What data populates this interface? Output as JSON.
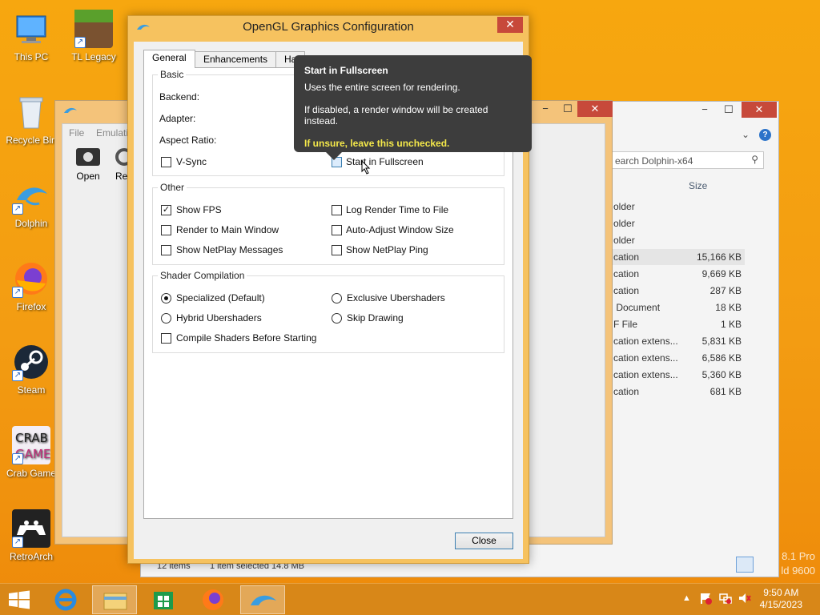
{
  "desktop": {
    "icons": [
      {
        "label": "This PC"
      },
      {
        "label": "TL Legacy"
      },
      {
        "label": "Recycle Bin"
      },
      {
        "label": "Dolphin"
      },
      {
        "label": "Firefox"
      },
      {
        "label": "Steam"
      },
      {
        "label": "Crab Game"
      },
      {
        "label": "RetroArch"
      }
    ],
    "watermark": [
      "8.1 Pro",
      "ld 9600"
    ]
  },
  "dolphin_main": {
    "menu": [
      "File",
      "Emulati"
    ],
    "toolbar": [
      "Open",
      "Re"
    ]
  },
  "explorer": {
    "search_placeholder": "earch Dolphin-x64",
    "size_header": "Size",
    "rows": [
      {
        "type": "older",
        "size": ""
      },
      {
        "type": "older",
        "size": ""
      },
      {
        "type": "older",
        "size": ""
      },
      {
        "type": "cation",
        "size": "15,166 KB"
      },
      {
        "type": "cation",
        "size": "9,669 KB"
      },
      {
        "type": "cation",
        "size": "287 KB"
      },
      {
        "type": " Document",
        "size": "18 KB"
      },
      {
        "type": "F File",
        "size": "1 KB"
      },
      {
        "type": "cation extens...",
        "size": "5,831 KB"
      },
      {
        "type": "cation extens...",
        "size": "6,586 KB"
      },
      {
        "type": "cation extens...",
        "size": "5,360 KB"
      },
      {
        "type": "cation",
        "size": "681 KB"
      }
    ],
    "status": {
      "items": "12 items",
      "selected": "1 item selected  14.8 MB"
    }
  },
  "dialog": {
    "title": "OpenGL Graphics Configuration",
    "tabs": [
      "General",
      "Enhancements",
      "Ha"
    ],
    "basic": {
      "title": "Basic",
      "backend_label": "Backend:",
      "adapter_label": "Adapter:",
      "aspect_label": "Aspect Ratio:",
      "vsync": "V-Sync",
      "fullscreen": "Start in Fullscreen"
    },
    "other": {
      "title": "Other",
      "show_fps": "Show FPS",
      "log_render": "Log Render Time to File",
      "render_main": "Render to Main Window",
      "auto_adjust": "Auto-Adjust Window Size",
      "netplay_msgs": "Show NetPlay Messages",
      "netplay_ping": "Show NetPlay Ping"
    },
    "shader": {
      "title": "Shader Compilation",
      "specialized": "Specialized (Default)",
      "exclusive": "Exclusive Ubershaders",
      "hybrid": "Hybrid Ubershaders",
      "skip": "Skip Drawing",
      "compile_before": "Compile Shaders Before Starting"
    },
    "close_label": "Close"
  },
  "tooltip": {
    "title": "Start in Fullscreen",
    "line1": "Uses the entire screen for rendering.",
    "line2": "If disabled, a render window will be created instead.",
    "warning": "If unsure, leave this unchecked."
  },
  "taskbar": {
    "time": "9:50 AM",
    "date": "4/15/2023"
  },
  "colors": {
    "desktop": "#f39c12",
    "dialog_frame": "#f6c25f",
    "close_red": "#c7493a",
    "tooltip_bg": "#3d3d3d",
    "tooltip_warning": "#f5e94a"
  }
}
